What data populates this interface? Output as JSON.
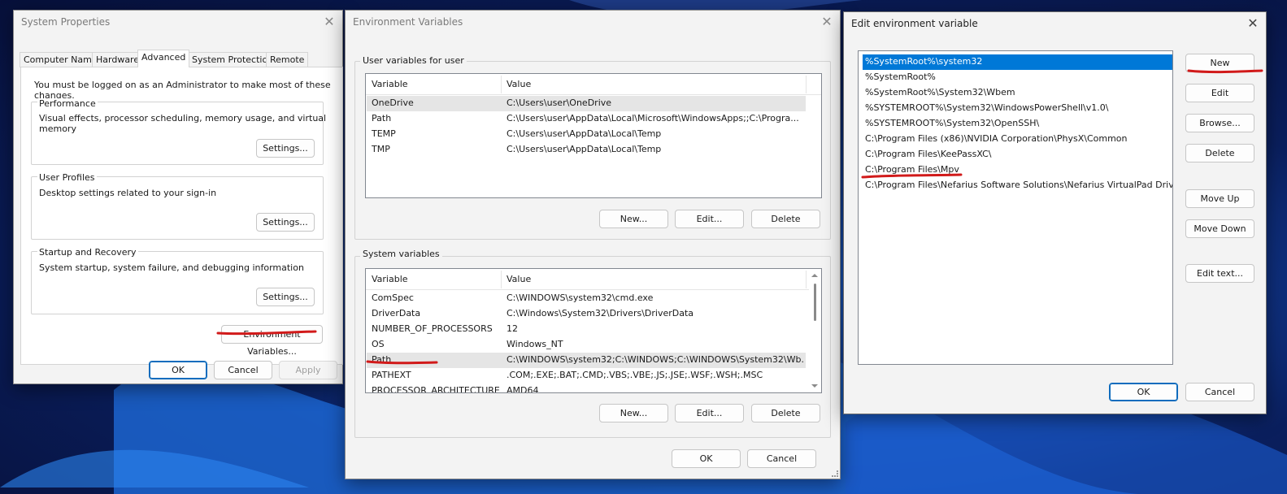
{
  "system_properties": {
    "title": "System Properties",
    "tabs": [
      "Computer Name",
      "Hardware",
      "Advanced",
      "System Protection",
      "Remote"
    ],
    "active_tab": "Advanced",
    "admin_notice": "You must be logged on as an Administrator to make most of these changes.",
    "performance": {
      "label": "Performance",
      "description": "Visual effects, processor scheduling, memory usage, and virtual memory",
      "button": "Settings..."
    },
    "user_profiles": {
      "label": "User Profiles",
      "description": "Desktop settings related to your sign-in",
      "button": "Settings..."
    },
    "startup_recovery": {
      "label": "Startup and Recovery",
      "description": "System startup, system failure, and debugging information",
      "button": "Settings..."
    },
    "env_vars_button": "Environment Variables...",
    "ok": "OK",
    "cancel": "Cancel",
    "apply": "Apply"
  },
  "environment_variables": {
    "title": "Environment Variables",
    "user_section_label": "User variables for user",
    "system_section_label": "System variables",
    "columns": {
      "variable": "Variable",
      "value": "Value"
    },
    "user_vars": [
      {
        "variable": "OneDrive",
        "value": "C:\\Users\\user\\OneDrive"
      },
      {
        "variable": "Path",
        "value": "C:\\Users\\user\\AppData\\Local\\Microsoft\\WindowsApps;;C:\\Progra..."
      },
      {
        "variable": "TEMP",
        "value": "C:\\Users\\user\\AppData\\Local\\Temp"
      },
      {
        "variable": "TMP",
        "value": "C:\\Users\\user\\AppData\\Local\\Temp"
      }
    ],
    "system_vars": [
      {
        "variable": "ComSpec",
        "value": "C:\\WINDOWS\\system32\\cmd.exe"
      },
      {
        "variable": "DriverData",
        "value": "C:\\Windows\\System32\\Drivers\\DriverData"
      },
      {
        "variable": "NUMBER_OF_PROCESSORS",
        "value": "12"
      },
      {
        "variable": "OS",
        "value": "Windows_NT"
      },
      {
        "variable": "Path",
        "value": "C:\\WINDOWS\\system32;C:\\WINDOWS;C:\\WINDOWS\\System32\\Wb..."
      },
      {
        "variable": "PATHEXT",
        "value": ".COM;.EXE;.BAT;.CMD;.VBS;.VBE;.JS;.JSE;.WSF;.WSH;.MSC"
      },
      {
        "variable": "PROCESSOR_ARCHITECTURE",
        "value": "AMD64"
      }
    ],
    "user_selected": "OneDrive",
    "system_selected": "Path",
    "buttons": {
      "new": "New...",
      "edit": "Edit...",
      "delete": "Delete",
      "ok": "OK",
      "cancel": "Cancel"
    }
  },
  "edit_env_var": {
    "title": "Edit environment variable",
    "entries": [
      "%SystemRoot%\\system32",
      "%SystemRoot%",
      "%SystemRoot%\\System32\\Wbem",
      "%SYSTEMROOT%\\System32\\WindowsPowerShell\\v1.0\\",
      "%SYSTEMROOT%\\System32\\OpenSSH\\",
      "C:\\Program Files (x86)\\NVIDIA Corporation\\PhysX\\Common",
      "C:\\Program Files\\KeePassXC\\",
      "C:\\Program Files\\Mpv",
      "C:\\Program Files\\Nefarius Software Solutions\\Nefarius VirtualPad Driv..."
    ],
    "selected": "%SystemRoot%\\system32",
    "buttons": {
      "new": "New",
      "edit": "Edit",
      "browse": "Browse...",
      "delete": "Delete",
      "move_up": "Move Up",
      "move_down": "Move Down",
      "edit_text": "Edit text...",
      "ok": "OK",
      "cancel": "Cancel"
    }
  },
  "colors": {
    "annotation_red": "#d11a1a",
    "selection_blue": "#0078d7",
    "accent": "#0f6cbd"
  },
  "icons": {
    "close": "close-icon"
  }
}
